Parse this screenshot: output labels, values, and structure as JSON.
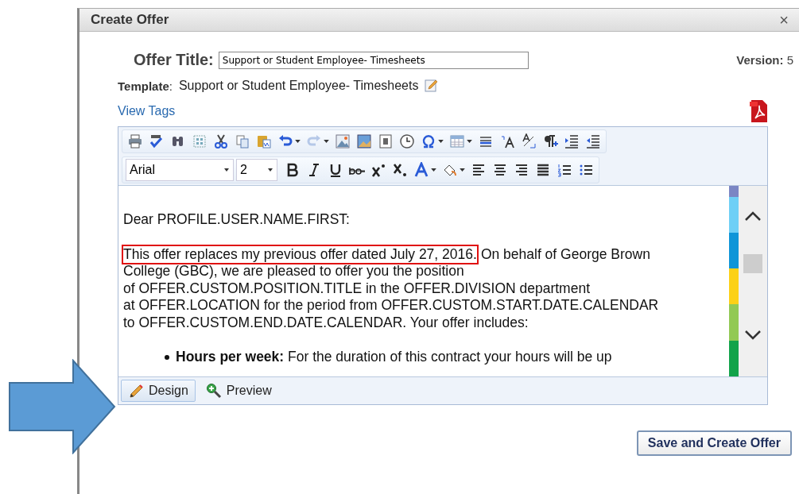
{
  "window": {
    "title": "Create Offer",
    "close": "×"
  },
  "offer_title": {
    "label": "Offer Title:",
    "value": "Support or Student Employee- Timesheets"
  },
  "version": {
    "label": "Version:",
    "value": "5"
  },
  "template": {
    "label": "Template",
    "colon": ":",
    "value": "Support or Student Employee- Timesheets"
  },
  "view_tags": "View Tags",
  "editor": {
    "font": "Arial",
    "size": "2",
    "greeting": "Dear PROFILE.USER.NAME.FIRST:",
    "highlighted": "This offer replaces my previous offer dated July 27, 2016.",
    "line_rest": "On behalf of George Brown",
    "lines": [
      "College (GBC), we are pleased to offer you the position",
      "of OFFER.CUSTOM.POSITION.TITLE in the OFFER.DIVISION department",
      "at OFFER.LOCATION for the period from OFFER.CUSTOM.START.DATE.CALENDAR",
      "to OFFER.CUSTOM.END.DATE.CALENDAR. Your offer includes:"
    ],
    "bullet": "**Hours per week:**   For the duration of this contract your hours will be up",
    "modes": [
      {
        "label": "Design",
        "selected": true
      },
      {
        "label": "Preview",
        "selected": false
      }
    ]
  },
  "save_button": "Save and Create Offer"
}
